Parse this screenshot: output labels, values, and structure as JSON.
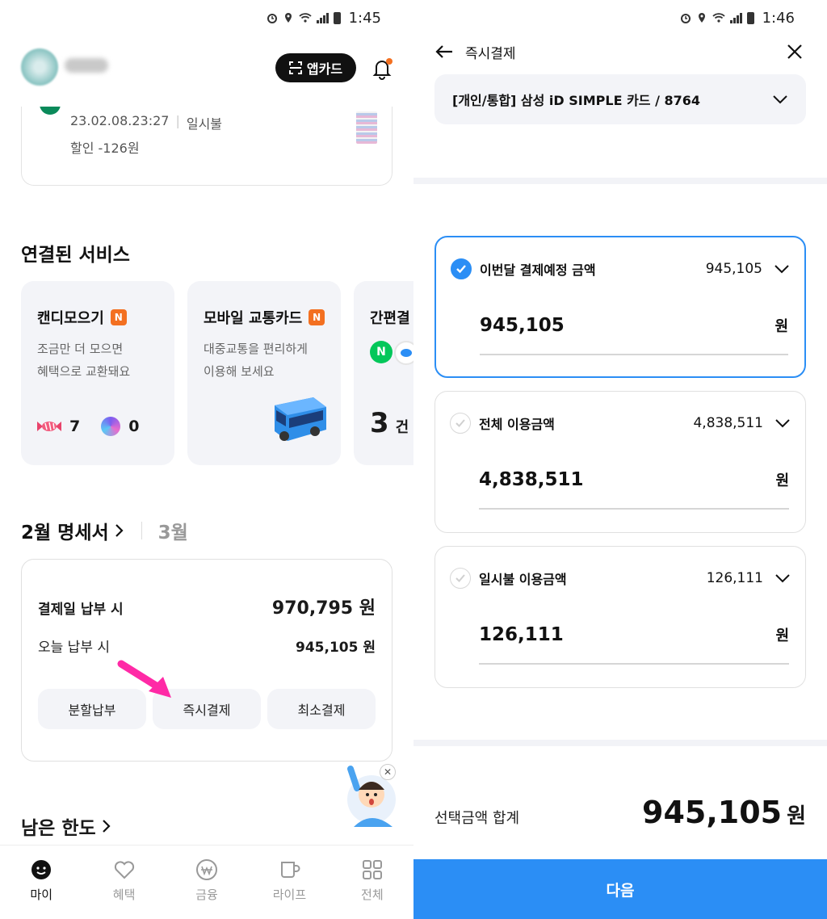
{
  "left": {
    "status": {
      "time": "1:45"
    },
    "header": {
      "app_card_label": "앱카드"
    },
    "recent_txn": {
      "datetime": "23.02.08.23:27",
      "type": "일시불",
      "discount": "할인 -126원"
    },
    "connected": {
      "title": "연결된 서비스",
      "candy": {
        "title": "캔디모으기",
        "badge": "N",
        "desc": "조금만 더 모으면\n혜택으로 교환돼요",
        "candy_count": "7",
        "lollipop_count": "0"
      },
      "transit": {
        "title": "모바일 교통카드",
        "badge": "N",
        "desc": "대중교통을 편리하게\n이용해 보세요"
      },
      "simple": {
        "title": "간편결",
        "naver_letter": "N",
        "count": "3",
        "unit": "건"
      }
    },
    "statement": {
      "current_month": "2월 명세서",
      "next_month": "3월",
      "due_label": "결제일 납부 시",
      "due_amount": "970,795 원",
      "today_label": "오늘 납부 시",
      "today_amount": "945,105 원",
      "buttons": [
        "분할납부",
        "즉시결제",
        "최소결제"
      ]
    },
    "limit_title": "남은 한도",
    "nav": [
      {
        "label": "마이",
        "icon": "smile-icon",
        "active": true
      },
      {
        "label": "혜택",
        "icon": "heart-icon",
        "active": false
      },
      {
        "label": "금융",
        "icon": "won-coin-icon",
        "active": false
      },
      {
        "label": "라이프",
        "icon": "cup-icon",
        "active": false
      },
      {
        "label": "전체",
        "icon": "grid-icon",
        "active": false
      }
    ]
  },
  "right": {
    "status": {
      "time": "1:46"
    },
    "title": "즉시결제",
    "card_select": "[개인/통합] 삼성 iD SIMPLE 카드 / 8764",
    "options": [
      {
        "label": "이번달 결제예정 금액",
        "sum": "945,105",
        "value": "945,105",
        "unit": "원",
        "selected": true
      },
      {
        "label": "전체 이용금액",
        "sum": "4,838,511",
        "value": "4,838,511",
        "unit": "원",
        "selected": false
      },
      {
        "label": "일시불 이용금액",
        "sum": "126,111",
        "value": "126,111",
        "unit": "원",
        "selected": false
      }
    ],
    "total_label": "선택금액 합계",
    "total_value": "945,105",
    "total_unit": "원",
    "next_label": "다음"
  },
  "colors": {
    "accent": "#2b8ef5",
    "badge": "#f37021",
    "card_bg": "#f3f4f8",
    "arrow": "#ff2aa6"
  }
}
